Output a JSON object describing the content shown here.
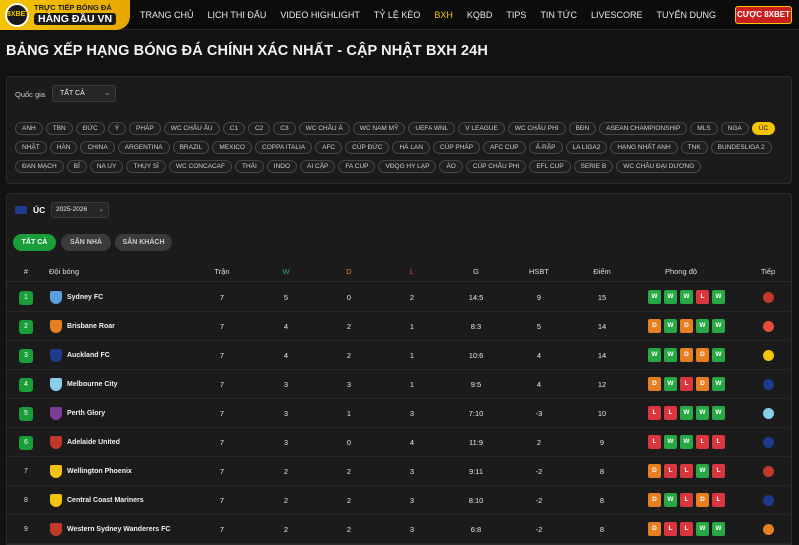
{
  "header": {
    "logo_line1": "TRỰC TIẾP BÓNG ĐÁ",
    "logo_line2": "HÀNG ĐẦU VN",
    "logo_badge": "8XBET",
    "nav": [
      "TRANG CHỦ",
      "LỊCH THI ĐẤU",
      "VIDEO HIGHLIGHT",
      "TỶ LỆ KÈO",
      "BXH",
      "KQBD",
      "TIPS",
      "TIN TỨC",
      "LIVESCORE",
      "TUYỂN DỤNG"
    ],
    "active_nav": "BXH",
    "cta_label": "CƯỢC 8XBET"
  },
  "page_title": "BẢNG XẾP HẠNG BÓNG ĐÁ CHÍNH XÁC NHẤT - CẬP NHẬT BXH 24H",
  "filter": {
    "country_label": "Quốc gia",
    "country_value": "TẤT CẢ",
    "leagues": [
      "ANH",
      "TBN",
      "ĐỨC",
      "Ý",
      "PHÁP",
      "WC CHÂU ÂU",
      "C1",
      "C2",
      "C3",
      "WC CHÂU Á",
      "WC NAM MỸ",
      "UEFA WNL",
      "V LEAGUE",
      "WC CHÂU PHI",
      "BĐN",
      "ASEAN CHAMPIONSHIP",
      "MLS",
      "NGA",
      "ÚC",
      "NHẬT",
      "HÀN",
      "CHINA",
      "ARGENTINA",
      "BRAZIL",
      "MEXICO",
      "COPPA ITALIA",
      "AFC",
      "CÚP ĐỨC",
      "HÀ LAN",
      "CÚP PHÁP",
      "AFC CUP",
      "Ả-RẬP",
      "LA LIGA2",
      "HẠNG NHẤT ANH",
      "TNK",
      "BUNDESLIGA 2",
      "ĐAN MẠCH",
      "BỈ",
      "NA UY",
      "THỤY SĨ",
      "WC CONCACAF",
      "THÁI",
      "INDO",
      "AI CẬP",
      "FA CUP",
      "VĐQG HY LẠP",
      "ÁO",
      "CÚP CHÂU PHI",
      "EFL CUP",
      "SERIE B",
      "WC CHÂU ĐẠI DƯƠNG"
    ],
    "active_league": "ÚC"
  },
  "standings": {
    "league_name": "ÚC",
    "season": "2025-2026",
    "tabs": [
      "TẤT CẢ",
      "SÂN NHÀ",
      "SÂN KHÁCH"
    ],
    "columns": [
      "#",
      "Đội bóng",
      "Trận",
      "W",
      "D",
      "L",
      "G",
      "HSBT",
      "Điểm",
      "Phong độ",
      "Tiếp"
    ],
    "rows": [
      {
        "rank": "1",
        "team": "Sydney FC",
        "played": "7",
        "w": "5",
        "d": "0",
        "l": "2",
        "g": "14:5",
        "gd": "9",
        "pts": "15",
        "form": [
          "W",
          "W",
          "W",
          "L",
          "W"
        ],
        "crest": "#5aa0e0",
        "next": "#c0392b"
      },
      {
        "rank": "2",
        "team": "Brisbane Roar",
        "played": "7",
        "w": "4",
        "d": "2",
        "l": "1",
        "g": "8:3",
        "gd": "5",
        "pts": "14",
        "form": [
          "D",
          "W",
          "D",
          "W",
          "W"
        ],
        "crest": "#e67e22",
        "next": "#e74c3c"
      },
      {
        "rank": "3",
        "team": "Auckland FC",
        "played": "7",
        "w": "4",
        "d": "2",
        "l": "1",
        "g": "10:6",
        "gd": "4",
        "pts": "14",
        "form": [
          "W",
          "W",
          "D",
          "D",
          "W"
        ],
        "crest": "#1e3a8a",
        "next": "#f1c40f"
      },
      {
        "rank": "4",
        "team": "Melbourne City",
        "played": "7",
        "w": "3",
        "d": "3",
        "l": "1",
        "g": "9:5",
        "gd": "4",
        "pts": "12",
        "form": [
          "D",
          "W",
          "L",
          "D",
          "W"
        ],
        "crest": "#87ceeb",
        "next": "#1e3a8a"
      },
      {
        "rank": "5",
        "team": "Perth Glory",
        "played": "7",
        "w": "3",
        "d": "1",
        "l": "3",
        "g": "7:10",
        "gd": "-3",
        "pts": "10",
        "form": [
          "L",
          "L",
          "W",
          "W",
          "W"
        ],
        "crest": "#7d3c98",
        "next": "#87ceeb"
      },
      {
        "rank": "6",
        "team": "Adelaide United",
        "played": "7",
        "w": "3",
        "d": "0",
        "l": "4",
        "g": "11:9",
        "gd": "2",
        "pts": "9",
        "form": [
          "L",
          "W",
          "W",
          "L",
          "L"
        ],
        "crest": "#c0392b",
        "next": "#1e3a8a"
      },
      {
        "rank": "7",
        "team": "Wellington Phoenix",
        "played": "7",
        "w": "2",
        "d": "2",
        "l": "3",
        "g": "9:11",
        "gd": "-2",
        "pts": "8",
        "form": [
          "D",
          "L",
          "L",
          "W",
          "L"
        ],
        "crest": "#f1c40f",
        "next": "#c0392b"
      },
      {
        "rank": "8",
        "team": "Central Coast Mariners",
        "played": "7",
        "w": "2",
        "d": "2",
        "l": "3",
        "g": "8:10",
        "gd": "-2",
        "pts": "8",
        "form": [
          "D",
          "W",
          "L",
          "D",
          "L"
        ],
        "crest": "#f1c40f",
        "next": "#1e3a8a"
      },
      {
        "rank": "9",
        "team": "Western Sydney Wanderers FC",
        "played": "7",
        "w": "2",
        "d": "2",
        "l": "3",
        "g": "6:8",
        "gd": "-2",
        "pts": "8",
        "form": [
          "D",
          "L",
          "L",
          "W",
          "W"
        ],
        "crest": "#c0392b",
        "next": "#e67e22"
      }
    ]
  }
}
